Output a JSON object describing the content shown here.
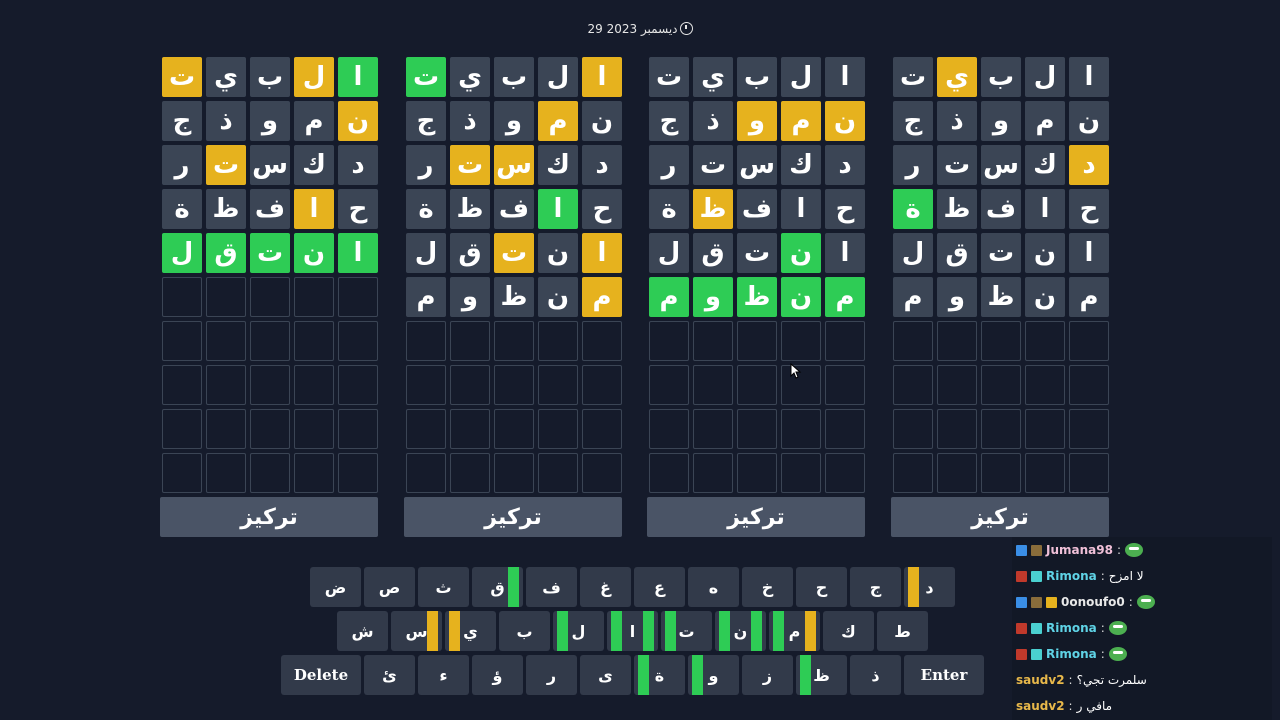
{
  "date": "29 ديسمبر 2023",
  "focus_label": "تركيز",
  "boards": [
    {
      "rows": [
        [
          [
            "ا",
            "x"
          ],
          [
            "ل",
            "x"
          ],
          [
            "ب",
            "x"
          ],
          [
            "ي",
            "y"
          ],
          [
            "ت",
            "x"
          ]
        ],
        [
          [
            "ن",
            "x"
          ],
          [
            "م",
            "x"
          ],
          [
            "و",
            "x"
          ],
          [
            "ذ",
            "x"
          ],
          [
            "ج",
            "x"
          ]
        ],
        [
          [
            "د",
            "y"
          ],
          [
            "ك",
            "x"
          ],
          [
            "س",
            "x"
          ],
          [
            "ت",
            "x"
          ],
          [
            "ر",
            "x"
          ]
        ],
        [
          [
            "ح",
            "x"
          ],
          [
            "ا",
            "x"
          ],
          [
            "ف",
            "x"
          ],
          [
            "ظ",
            "x"
          ],
          [
            "ة",
            "g"
          ]
        ],
        [
          [
            "ا",
            "x"
          ],
          [
            "ن",
            "x"
          ],
          [
            "ت",
            "x"
          ],
          [
            "ق",
            "x"
          ],
          [
            "ل",
            "x"
          ]
        ],
        [
          [
            "م",
            "x"
          ],
          [
            "ن",
            "x"
          ],
          [
            "ظ",
            "x"
          ],
          [
            "و",
            "x"
          ],
          [
            "م",
            "x"
          ]
        ]
      ]
    },
    {
      "rows": [
        [
          [
            "ا",
            "x"
          ],
          [
            "ل",
            "x"
          ],
          [
            "ب",
            "x"
          ],
          [
            "ي",
            "x"
          ],
          [
            "ت",
            "x"
          ]
        ],
        [
          [
            "ن",
            "y"
          ],
          [
            "م",
            "y"
          ],
          [
            "و",
            "y"
          ],
          [
            "ذ",
            "x"
          ],
          [
            "ج",
            "x"
          ]
        ],
        [
          [
            "د",
            "x"
          ],
          [
            "ك",
            "x"
          ],
          [
            "س",
            "x"
          ],
          [
            "ت",
            "x"
          ],
          [
            "ر",
            "x"
          ]
        ],
        [
          [
            "ح",
            "x"
          ],
          [
            "ا",
            "x"
          ],
          [
            "ف",
            "x"
          ],
          [
            "ظ",
            "y"
          ],
          [
            "ة",
            "x"
          ]
        ],
        [
          [
            "ا",
            "x"
          ],
          [
            "ن",
            "g"
          ],
          [
            "ت",
            "x"
          ],
          [
            "ق",
            "x"
          ],
          [
            "ل",
            "x"
          ]
        ],
        [
          [
            "م",
            "g"
          ],
          [
            "ن",
            "g"
          ],
          [
            "ظ",
            "g"
          ],
          [
            "و",
            "g"
          ],
          [
            "م",
            "g"
          ]
        ]
      ]
    },
    {
      "rows": [
        [
          [
            "ا",
            "y"
          ],
          [
            "ل",
            "x"
          ],
          [
            "ب",
            "x"
          ],
          [
            "ي",
            "x"
          ],
          [
            "ت",
            "g"
          ]
        ],
        [
          [
            "ن",
            "x"
          ],
          [
            "م",
            "y"
          ],
          [
            "و",
            "x"
          ],
          [
            "ذ",
            "x"
          ],
          [
            "ج",
            "x"
          ]
        ],
        [
          [
            "د",
            "x"
          ],
          [
            "ك",
            "x"
          ],
          [
            "س",
            "y"
          ],
          [
            "ت",
            "y"
          ],
          [
            "ر",
            "x"
          ]
        ],
        [
          [
            "ح",
            "x"
          ],
          [
            "ا",
            "g"
          ],
          [
            "ف",
            "x"
          ],
          [
            "ظ",
            "x"
          ],
          [
            "ة",
            "x"
          ]
        ],
        [
          [
            "ا",
            "y"
          ],
          [
            "ن",
            "x"
          ],
          [
            "ت",
            "y"
          ],
          [
            "ق",
            "x"
          ],
          [
            "ل",
            "x"
          ]
        ],
        [
          [
            "م",
            "y"
          ],
          [
            "ن",
            "x"
          ],
          [
            "ظ",
            "x"
          ],
          [
            "و",
            "x"
          ],
          [
            "م",
            "x"
          ]
        ]
      ]
    },
    {
      "rows": [
        [
          [
            "ا",
            "g"
          ],
          [
            "ل",
            "y"
          ],
          [
            "ب",
            "x"
          ],
          [
            "ي",
            "x"
          ],
          [
            "ت",
            "y"
          ]
        ],
        [
          [
            "ن",
            "y"
          ],
          [
            "م",
            "x"
          ],
          [
            "و",
            "x"
          ],
          [
            "ذ",
            "x"
          ],
          [
            "ج",
            "x"
          ]
        ],
        [
          [
            "د",
            "x"
          ],
          [
            "ك",
            "x"
          ],
          [
            "س",
            "x"
          ],
          [
            "ت",
            "y"
          ],
          [
            "ر",
            "x"
          ]
        ],
        [
          [
            "ح",
            "x"
          ],
          [
            "ا",
            "y"
          ],
          [
            "ف",
            "x"
          ],
          [
            "ظ",
            "x"
          ],
          [
            "ة",
            "x"
          ]
        ],
        [
          [
            "ا",
            "g"
          ],
          [
            "ن",
            "g"
          ],
          [
            "ت",
            "g"
          ],
          [
            "ق",
            "g"
          ],
          [
            "ل",
            "g"
          ]
        ]
      ]
    }
  ],
  "keyboard": {
    "row1": [
      {
        "k": "د",
        "bars": [
          [
            "y",
            "left"
          ]
        ]
      },
      {
        "k": "ج"
      },
      {
        "k": "ح"
      },
      {
        "k": "خ"
      },
      {
        "k": "ه"
      },
      {
        "k": "ع"
      },
      {
        "k": "غ"
      },
      {
        "k": "ف"
      },
      {
        "k": "ق",
        "bars": [
          [
            "g",
            "right"
          ]
        ]
      },
      {
        "k": "ث"
      },
      {
        "k": "ص"
      },
      {
        "k": "ض"
      }
    ],
    "row2": [
      {
        "k": "ط"
      },
      {
        "k": "ك"
      },
      {
        "k": "م",
        "bars": [
          [
            "y",
            "right"
          ],
          [
            "g",
            "left"
          ]
        ]
      },
      {
        "k": "ن",
        "bars": [
          [
            "g",
            "right"
          ],
          [
            "g",
            "left"
          ]
        ]
      },
      {
        "k": "ت",
        "bars": [
          [
            "g",
            "left"
          ]
        ]
      },
      {
        "k": "ا",
        "bars": [
          [
            "g",
            "right"
          ],
          [
            "g",
            "left"
          ]
        ]
      },
      {
        "k": "ل",
        "bars": [
          [
            "g",
            "left"
          ]
        ]
      },
      {
        "k": "ب"
      },
      {
        "k": "ي",
        "bars": [
          [
            "y",
            "left"
          ]
        ]
      },
      {
        "k": "س",
        "bars": [
          [
            "y",
            "right"
          ]
        ]
      },
      {
        "k": "ش"
      }
    ],
    "row3": [
      {
        "k": "Enter",
        "wide": true
      },
      {
        "k": "ذ"
      },
      {
        "k": "ظ",
        "bars": [
          [
            "g",
            "left"
          ]
        ]
      },
      {
        "k": "ز"
      },
      {
        "k": "و",
        "bars": [
          [
            "g",
            "left"
          ]
        ]
      },
      {
        "k": "ة",
        "bars": [
          [
            "g",
            "left"
          ]
        ]
      },
      {
        "k": "ى"
      },
      {
        "k": "ر"
      },
      {
        "k": "ؤ"
      },
      {
        "k": "ء"
      },
      {
        "k": "ئ"
      },
      {
        "k": "Delete",
        "wide": true
      }
    ]
  },
  "chat": [
    {
      "user": "Jumana98",
      "color": "#f0c0d8",
      "badges": [
        "#3a8ee6",
        "#8a6d3b"
      ],
      "text": "",
      "emote": true
    },
    {
      "user": "Rimona",
      "color": "#5fd3e6",
      "badges": [
        "#c0392b",
        "#4ad0d0"
      ],
      "text": "لا امزح",
      "emote": false
    },
    {
      "user": "0onoufo0",
      "color": "#e8e8e8",
      "badges": [
        "#3a8ee6",
        "#8a6d3b",
        "#e6b21e"
      ],
      "text": "",
      "emote": true
    },
    {
      "user": "Rimona",
      "color": "#5fd3e6",
      "badges": [
        "#c0392b",
        "#4ad0d0"
      ],
      "text": "",
      "emote": true
    },
    {
      "user": "Rimona",
      "color": "#5fd3e6",
      "badges": [
        "#c0392b",
        "#4ad0d0"
      ],
      "text": "",
      "emote": true
    },
    {
      "user": "saudv2",
      "color": "#e8b84a",
      "badges": [],
      "text": "سلمرت تجي؟",
      "emote": false
    },
    {
      "user": "saudv2",
      "color": "#e8b84a",
      "badges": [],
      "text": "مافي ر",
      "emote": false
    }
  ],
  "colors": {
    "green": "#2ecc55",
    "yellow": "#e6b21e",
    "tile": "#3b4555",
    "key": "#323a4a",
    "bg": "#151b2b"
  }
}
